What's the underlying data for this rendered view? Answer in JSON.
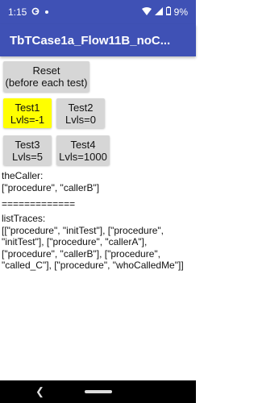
{
  "status_bar": {
    "time": "1:15",
    "battery": "9%"
  },
  "app_bar": {
    "title": "TbTCase1a_Flow11B_noC..."
  },
  "buttons": {
    "reset": {
      "line1": "Reset",
      "line2": "(before each test)"
    },
    "test1": {
      "line1": "Test1",
      "line2": "Lvls=-1"
    },
    "test2": {
      "line1": "Test2",
      "line2": "Lvls=0"
    },
    "test3": {
      "line1": "Test3",
      "line2": "Lvls=5"
    },
    "test4": {
      "line1": "Test4",
      "line2": "Lvls=1000"
    }
  },
  "output": {
    "the_caller_label": "theCaller:",
    "the_caller_value": "[\"procedure\", \"callerB\"]",
    "separator": "=============",
    "list_traces_label": "listTraces:",
    "list_traces_value": "[[\"procedure\", \"initTest\"], [\"procedure\", \"initTest\"], [\"procedure\", \"callerA\"], [\"procedure\", \"callerB\"], [\"procedure\", \"called_C\"], [\"procedure\", \"whoCalledMe\"]]"
  },
  "colors": {
    "primary": "#3f51b5",
    "highlight": "#ffff00",
    "button": "#d6d6d6"
  },
  "icons": [
    "g-icon",
    "dot-icon",
    "wifi-icon",
    "signal-icon",
    "battery-icon",
    "back-icon",
    "home-pill"
  ]
}
